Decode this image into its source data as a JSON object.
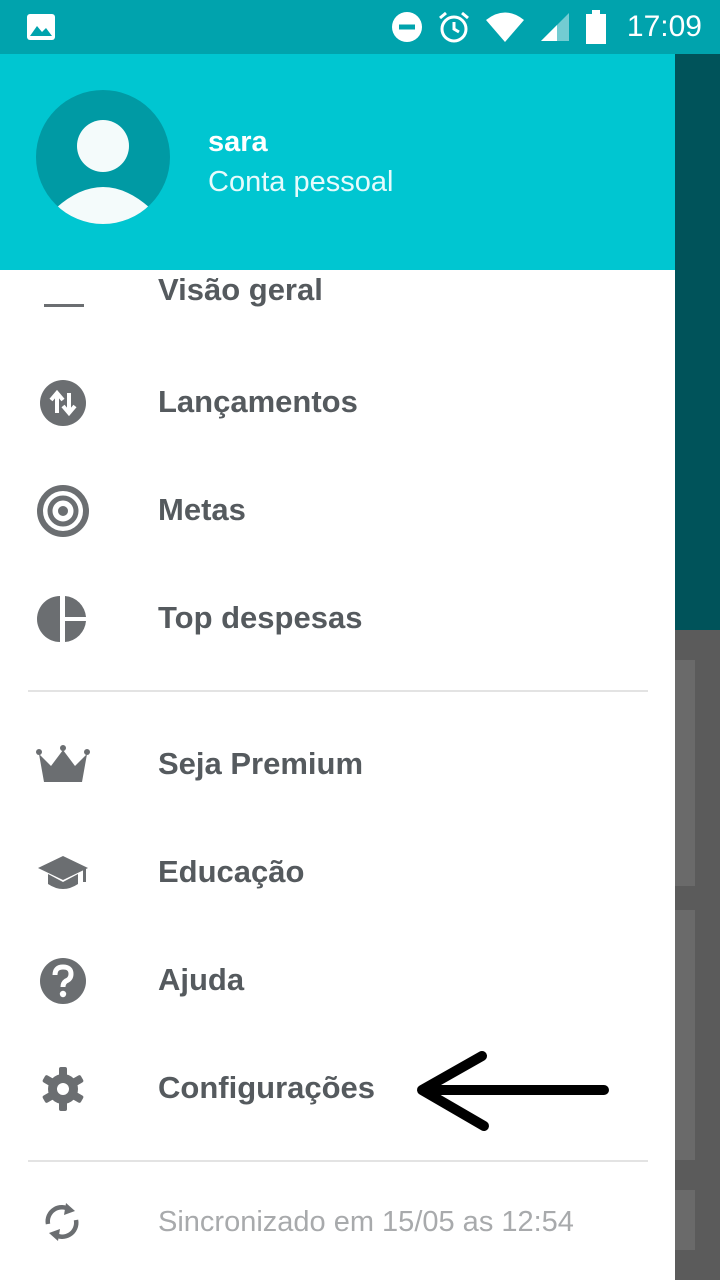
{
  "status_bar": {
    "time": "17:09",
    "icons": [
      "image-icon",
      "do-not-disturb-icon",
      "alarm-icon",
      "wifi-icon",
      "signal-icon",
      "battery-icon"
    ]
  },
  "header": {
    "user_name": "sara",
    "account_type": "Conta pessoal",
    "color": "#00c6d1"
  },
  "menu": {
    "partial_item": "Visão geral",
    "items": [
      {
        "label": "Lançamentos",
        "icon": "transfer-arrows-icon"
      },
      {
        "label": "Metas",
        "icon": "target-icon"
      },
      {
        "label": "Top despesas",
        "icon": "pie-chart-icon"
      },
      {
        "label": "Seja Premium",
        "icon": "crown-icon"
      },
      {
        "label": "Educação",
        "icon": "graduation-cap-icon"
      },
      {
        "label": "Ajuda",
        "icon": "help-icon"
      },
      {
        "label": "Configurações",
        "icon": "gear-icon"
      }
    ]
  },
  "sync": {
    "text": "Sincronizado em 15/05 as 12:54",
    "icon": "sync-icon"
  },
  "colors": {
    "accent": "#00c6d1",
    "status_bar": "#00a3ad",
    "text": "#555a5e",
    "muted_text": "#a8aaac"
  }
}
